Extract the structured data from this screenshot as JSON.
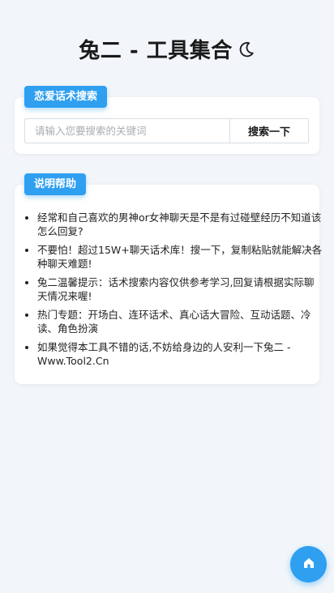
{
  "header": {
    "title": "兔二 - 工具集合",
    "theme_icon": "moon-icon"
  },
  "search": {
    "badge_label": "恋爱话术搜索",
    "placeholder": "请输入您要搜索的关键词",
    "value": "",
    "button_label": "搜索一下"
  },
  "help": {
    "badge_label": "说明帮助",
    "items": [
      "经常和自己喜欢的男神or女神聊天是不是有过碰壁经历不知道该怎么回复?",
      "不要怕！超过15W+聊天话术库！搜一下，复制粘贴就能解决各种聊天难题!",
      "兔二温馨提示：话术搜索内容仅供参考学习,回复请根据实际聊天情况来喔!",
      "热门专题：开场白、连环话术、真心话大冒险、互动话题、冷读、角色扮演",
      "如果觉得本工具不错的话,不妨给身边的人安利一下兔二 - Www.Tool2.Cn"
    ]
  },
  "fab": {
    "icon": "home-icon"
  },
  "colors": {
    "accent": "#2f9ff0",
    "background": "#f2f6fa"
  }
}
